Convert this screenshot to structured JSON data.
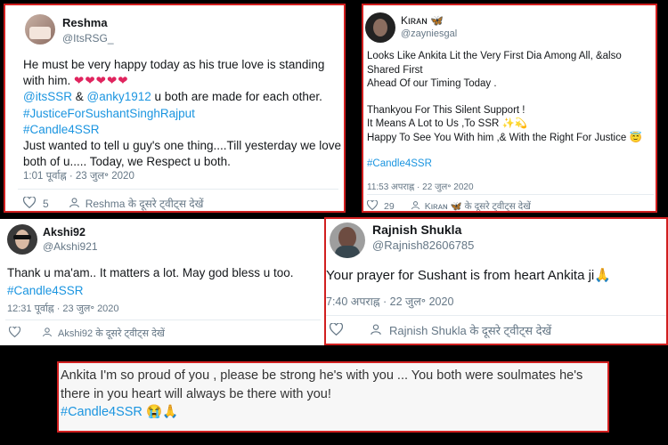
{
  "tweets": {
    "reshma": {
      "name": "Reshma",
      "handle": "@ItsRSG_",
      "text1": "He must be very happy today as his true love is standing with him.",
      "hearts": "❤❤❤❤❤",
      "mentions_a": "@itsSSR",
      "amp": " & ",
      "mentions_b": "@anky1912",
      "mentions_rest": " u both are made for each other.",
      "hashtag1": "#JusticeForSushantSinghRajput",
      "hashtag2": "#Candle4SSR",
      "text2": "Just wanted to tell u guy's one thing....Till yesterday we love both of u..... Today, we Respect u both.",
      "time": "1:01 पूर्वाह्न · 23 जुल॰ 2020",
      "likes": "5",
      "more": "Reshma के दूसरे ट्वीट्स देखें"
    },
    "kiran": {
      "name": "Kιʀᴀɴ",
      "badge": "🦋",
      "handle": "@zayniesgal",
      "line1": "Looks Like Ankita Lit the Very First Dia Among All, &also Shared First",
      "line2": "Ahead Of our Timing Today .",
      "line3": "Thankyou For This Silent Support !",
      "line4": "It Means A Lot to Us ,To SSR",
      "line4_emoji": "✨💫",
      "line5": "Happy To See You With him ,& With  the Right For Justice",
      "line5_emoji": "😇",
      "hashtag": "#Candle4SSR",
      "time": "11:53 अपराह्न · 22 जुल॰ 2020",
      "likes": "29",
      "more": "Kιʀᴀɴ 🦋 के दूसरे ट्वीट्स देखें"
    },
    "akshi": {
      "name": "Akshi92",
      "handle": "@Akshi921",
      "text": "Thank u ma'am.. It matters a lot. May god bless u too.",
      "hashtag": "#Candle4SSR",
      "time": "12:31 पूर्वाह्न · 23 जुल॰ 2020",
      "more": "Akshi92 के दूसरे ट्वीट्स देखें"
    },
    "rajnish": {
      "name": "Rajnish Shukla",
      "handle": "@Rajnish82606785",
      "text": "Your prayer for Sushant is from heart Ankita ji",
      "emoji": "🙏",
      "time": "7:40 अपराह्न · 22 जुल॰ 2020",
      "more": "Rajnish Shukla के दूसरे ट्वीट्स देखें"
    },
    "bottom": {
      "text": "Ankita I'm so proud of you , please be strong he's with you ... You both were soulmates he's there in you heart will always be there with you!",
      "hashtag": "#Candle4SSR",
      "emoji": "😭🙏"
    }
  },
  "colors": {
    "border_red": "#d11f1f",
    "link_blue": "#1b95e0",
    "meta_gray": "#657786",
    "heart_red": "#e0245e"
  }
}
